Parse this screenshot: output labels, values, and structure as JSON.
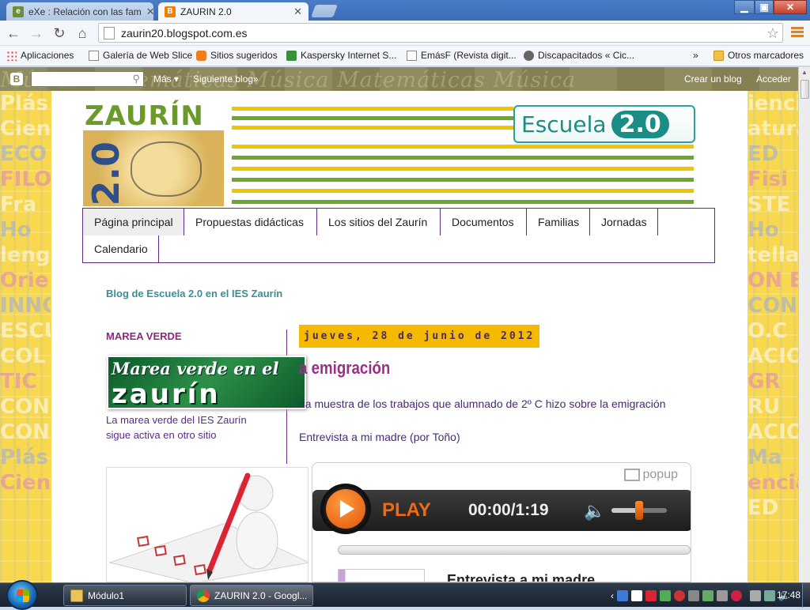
{
  "browser": {
    "tabs": [
      {
        "title": "eXe : Relación con las fam",
        "active": false
      },
      {
        "title": "ZAURIN 2.0",
        "active": true
      }
    ],
    "url": "zaurin20.blogspot.com.es"
  },
  "bookmarks": {
    "items": [
      "Aplicaciones",
      "Galería de Web Slice",
      "Sitios sugeridos",
      "Kaspersky Internet S...",
      "EmásF (Revista digit...",
      "Discapacitados « Cic..."
    ],
    "overflow": "»",
    "other": "Otros marcadores"
  },
  "blogger_bar": {
    "more": "Más",
    "next_blog": "Siguiente blog»",
    "create_blog": "Crear un blog",
    "sign_in": "Acceder",
    "background_words": "Música Matemáticas Música Matemáticas Música"
  },
  "header": {
    "logo_text": "ZAURÍN",
    "logo_number": "2.0",
    "badge_word": "Escuela",
    "badge_version": "2.0"
  },
  "nav": {
    "tabs": [
      "Página principal",
      "Propuestas didácticas",
      "Los sitios del Zaurín",
      "Documentos",
      "Familias",
      "Jornadas",
      "Calendario"
    ]
  },
  "blog_description": "Blog de Escuela 2.0 en el IES Zaurín",
  "sidebar": {
    "marea_title": "MAREA VERDE",
    "marea_image_line1": "Marea verde en el",
    "marea_image_line2": "zaurín",
    "marea_caption": "La marea verde del IES Zaurín sigue activa en otro sitio"
  },
  "post": {
    "date": "jueves, 28 de junio de 2012",
    "title": "a emigración",
    "intro": "na muestra de los trabajos que alumnado de 2º C hizo sobre la emigración",
    "link": "Entrevista a mi madre (por Toño)"
  },
  "player": {
    "popup": "popup",
    "play_label": "PLAY",
    "time": "00:00/1:19",
    "volume_level": 0.5,
    "audio_title": "Entrevista a mi madre"
  },
  "deco_words": {
    "left": [
      "Plás",
      "Cien",
      "ECO",
      "FILO",
      "Fra",
      "Ho",
      "lengu",
      "Orie",
      "INNO",
      "ESCU",
      "COL",
      "TIC",
      "CON",
      "CON",
      "Plás",
      "Cien"
    ],
    "right": [
      "iencia",
      "atura",
      "ED",
      "Fisi",
      "STE",
      "Ho",
      "tella",
      "ON E",
      "CON",
      "O.C",
      "ACIO",
      "GR",
      "RU",
      "ACIO",
      "Ma",
      "encia",
      "ED"
    ]
  },
  "taskbar": {
    "tasks": [
      "Módulo1",
      "ZAURIN 2.0 - Googl..."
    ],
    "clock": "17:48"
  },
  "colors": {
    "accent_purple": "#9b2f86",
    "teal": "#3b8f98",
    "date_bg": "#f5b900",
    "page_bg": "#f7d84f"
  }
}
